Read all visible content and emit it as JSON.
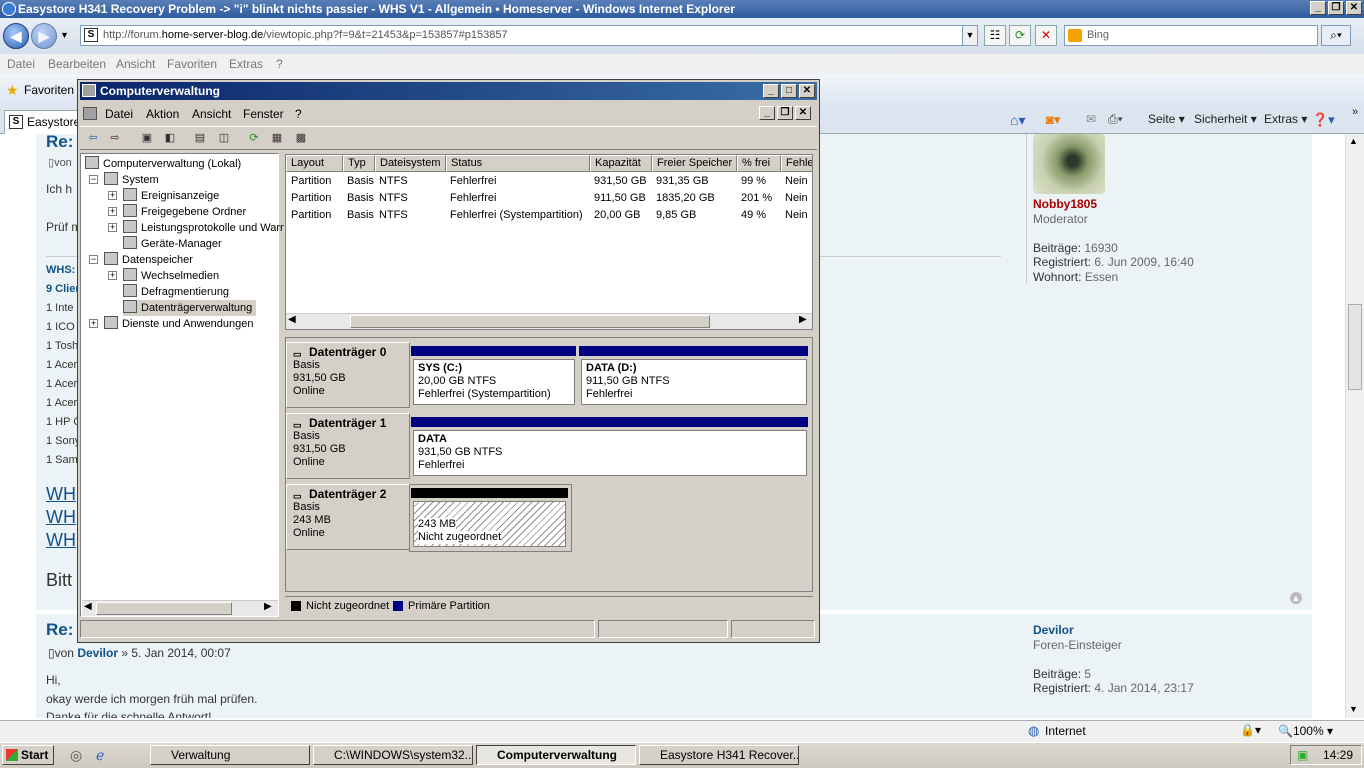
{
  "ie": {
    "title": "Easystore H341 Recovery Problem -> \"i\" blinkt nichts passier - WHS V1 - Allgemein • Homeserver  - Windows Internet Explorer",
    "address_pre": "http://forum.",
    "address_domain": "home-server-blog.de",
    "address_post": "/viewtopic.php?f=9&t=21453&p=153857#p153857",
    "search_placeholder": "Bing",
    "menu": [
      "Datei",
      "Bearbeiten",
      "Ansicht",
      "Favoriten",
      "Extras",
      "?"
    ],
    "favorites_label": "Favoriten",
    "tab_label": "Easystore",
    "commands": [
      "Seite",
      "Sicherheit",
      "Extras"
    ],
    "status_zone": "Internet",
    "zoom": "100%"
  },
  "web": {
    "post1": {
      "title": "Re:",
      "by": "von",
      "lines": [
        "Ich h",
        "Prüf m"
      ],
      "sig_head": "WHS:",
      "sig_clients": "9 Clien",
      "sig_items": [
        "1 Inte",
        "1 ICO",
        "1 Tosh",
        "1 Acer",
        "1 Acer",
        "1 Acer",
        "1 HP C",
        "1 Sony",
        "1 Sams"
      ],
      "links": [
        "WH",
        "WH",
        "WH"
      ],
      "bitte": "Bitt",
      "author": "Nobby1805",
      "rank": "Moderator",
      "posts_label": "Beiträge:",
      "posts": "16930",
      "registered_label": "Registriert:",
      "registered": "6. Jun 2009, 16:40",
      "location_label": "Wohnort:",
      "location": "Essen"
    },
    "post2": {
      "title": "Re:",
      "byline_von": "von",
      "byline_author": "Devilor",
      "byline_date": "» 5. Jan 2014, 00:07",
      "lines": [
        "Hi,",
        "okay werde ich morgen früh mal prüfen.",
        "Danke für die schnelle Antwort!"
      ],
      "author": "Devilor",
      "rank": "Foren-Einsteiger",
      "posts_label": "Beiträge:",
      "posts": "5",
      "registered_label": "Registriert:",
      "registered": "4. Jan 2014, 23:17"
    }
  },
  "taskbar": {
    "start": "Start",
    "items": [
      "Verwaltung",
      "C:\\WINDOWS\\system32...",
      "Computerverwaltung",
      "Easystore H341 Recover..."
    ],
    "clock": "14:29"
  },
  "mmc": {
    "title": "Computerverwaltung",
    "menu": [
      "Datei",
      "Aktion",
      "Ansicht",
      "Fenster",
      "?"
    ],
    "tree": [
      "Computerverwaltung (Lokal)",
      "System",
      "Ereignisanzeige",
      "Freigegebene Ordner",
      "Leistungsprotokolle und Warn",
      "Geräte-Manager",
      "Datenspeicher",
      "Wechselmedien",
      "Defragmentierung",
      "Datenträgerverwaltung",
      "Dienste und Anwendungen"
    ],
    "columns": [
      "Layout",
      "Typ",
      "Dateisystem",
      "Status",
      "Kapazität",
      "Freier Speicher",
      "% frei",
      "Fehler"
    ],
    "rows": [
      [
        "Partition",
        "Basis",
        "NTFS",
        "Fehlerfrei",
        "931,50 GB",
        "931,35 GB",
        "99 %",
        "Nein"
      ],
      [
        "Partition",
        "Basis",
        "NTFS",
        "Fehlerfrei",
        "911,50 GB",
        "1835,20 GB",
        "201 %",
        "Nein"
      ],
      [
        "Partition",
        "Basis",
        "NTFS",
        "Fehlerfrei (Systempartition)",
        "20,00 GB",
        "9,85 GB",
        "49 %",
        "Nein"
      ]
    ],
    "disks": [
      {
        "name": "Datenträger 0",
        "type": "Basis",
        "size": "931,50 GB",
        "state": "Online",
        "volumes": [
          {
            "name": "SYS  (C:)",
            "size": "20,00 GB NTFS",
            "status": "Fehlerfrei (Systempartition)"
          },
          {
            "name": "DATA  (D:)",
            "size": "911,50 GB NTFS",
            "status": "Fehlerfrei"
          }
        ]
      },
      {
        "name": "Datenträger 1",
        "type": "Basis",
        "size": "931,50 GB",
        "state": "Online",
        "volumes": [
          {
            "name": "DATA",
            "size": "931,50 GB NTFS",
            "status": "Fehlerfrei"
          }
        ]
      },
      {
        "name": "Datenträger 2",
        "type": "Basis",
        "size": "243 MB",
        "state": "Online",
        "volumes": [
          {
            "name": "",
            "size": "243 MB",
            "status": "Nicht zugeordnet"
          }
        ]
      }
    ],
    "legend": [
      "Nicht zugeordnet",
      "Primäre Partition"
    ],
    "colors": {
      "primary": "#000080",
      "unallocated": "#000000"
    }
  }
}
